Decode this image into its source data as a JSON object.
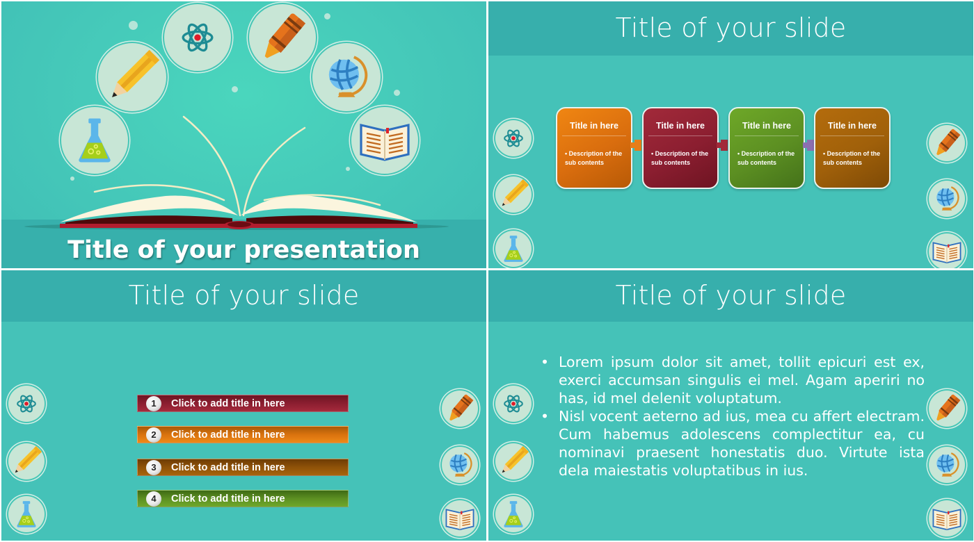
{
  "slides": {
    "title_slide": {
      "title": "Title of your presentation",
      "icons": [
        "flask-icon",
        "pencil-icon",
        "atom-icon",
        "crayon-icon",
        "globe-icon",
        "open-book-icon"
      ]
    },
    "process_slide": {
      "title": "Title of your slide",
      "steps": [
        {
          "title": "Title in here",
          "description": "• Description of the sub contents",
          "color": "#e07a10"
        },
        {
          "title": "Title in here",
          "description": "• Description of the sub contents",
          "color": "#8b1e30"
        },
        {
          "title": "Title in here",
          "description": "• Description of the sub contents",
          "color": "#5c8f22"
        },
        {
          "title": "Title in here",
          "description": "• Description of the sub contents",
          "color": "#a0600a"
        }
      ],
      "arrow_colors": [
        "#e67e1a",
        "#a22a3a",
        "#8c6fb0"
      ]
    },
    "list_slide": {
      "title": "Title of your slide",
      "items": [
        {
          "number": "1",
          "label": "Click to add title in here",
          "color": "#8b1e30"
        },
        {
          "number": "2",
          "label": "Click to add title in here",
          "color": "#e07a10"
        },
        {
          "number": "3",
          "label": "Click to add title in here",
          "color": "#99580a"
        },
        {
          "number": "4",
          "label": "Click to add title in here",
          "color": "#5c8f22"
        }
      ]
    },
    "text_slide": {
      "title": "Title of your slide",
      "bullets": [
        "Lorem ipsum dolor sit amet, tollit epicuri est ex, exerci accumsan singulis ei mel. Agam aperiri no has, id mel delenit voluptatum.",
        "Nisl vocent aeterno ad ius, mea cu affert electram. Cum habemus adolescens complectitur ea, cu nominavi praesent honestatis duo. Virtute ista dela maiestatis voluptatibus in ius."
      ]
    }
  },
  "side_icons": {
    "left": [
      "atom-icon",
      "pencil-icon",
      "flask-icon"
    ],
    "right": [
      "crayon-icon",
      "globe-icon",
      "open-book-icon"
    ]
  },
  "colors": {
    "background": "#45c2b8",
    "header_band": "#37afac",
    "bubble": "#c8e6d6"
  }
}
